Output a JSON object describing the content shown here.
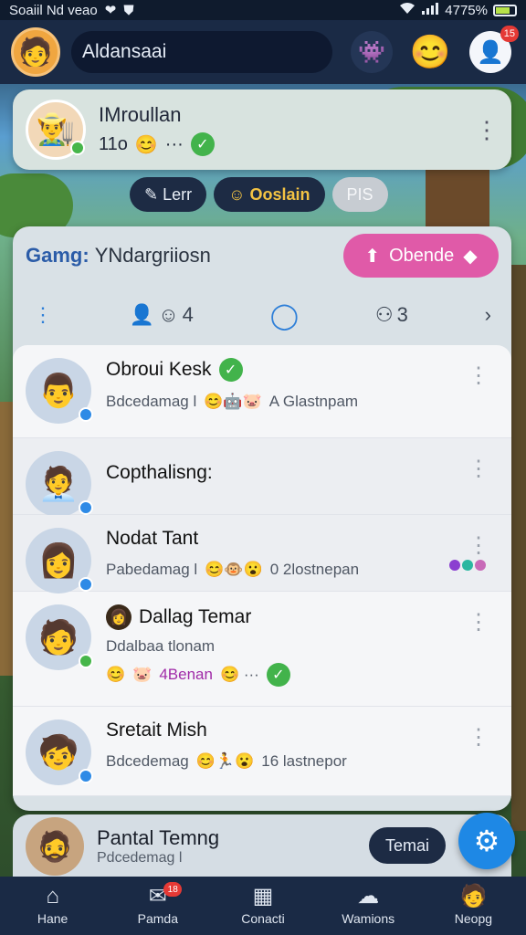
{
  "status_bar": {
    "carrier": "Soaiil Nd veao",
    "battery": "4775%"
  },
  "top_bar": {
    "search_value": "Aldansaai",
    "profile_badge": "15"
  },
  "featured": {
    "name": "IMroullan",
    "meta": "11o"
  },
  "pills": {
    "first": "Lerr",
    "second": "Ooslain",
    "third": "PIS"
  },
  "panel": {
    "title_prefix": "Gamg:",
    "title_rest": "YNdargriiosn",
    "open_button": "Obende",
    "filters": {
      "second_count": "4",
      "fourth_count": "3"
    }
  },
  "contacts": [
    {
      "name": "Obroui Kesk",
      "sub_text": "Bdcedamag l",
      "sub_tail": "A Glastnpam"
    },
    {
      "name": "Copthalisng:"
    },
    {
      "name": "Nodat Tant",
      "sub_text": "Pabedamag l",
      "sub_tail": "0 2lostnepan"
    },
    {
      "name": "Dallag Temar",
      "sub_text": "Ddalbaa tlonam",
      "sub_tail": "4Benan"
    },
    {
      "name": "Sretait Mish",
      "sub_text": "Bdcedemag",
      "sub_tail": "16 lastnepor"
    }
  ],
  "peek": {
    "name": "Pantal Temng",
    "sub_text": "Pdcedemag l",
    "button": "Temai"
  },
  "bottom_nav": {
    "items": [
      {
        "label": "Hane",
        "icon": "home-icon"
      },
      {
        "label": "Pamda",
        "icon": "chat-icon",
        "badge": "18"
      },
      {
        "label": "Conacti",
        "icon": "contacts-icon"
      },
      {
        "label": "Wamions",
        "icon": "game-icon"
      },
      {
        "label": "Neopg",
        "icon": "profile-icon"
      }
    ]
  },
  "colors": {
    "accent_blue": "#1e88e5",
    "pink_button": "#e05aa8",
    "dark_nav": "#1a2a45",
    "badge_red": "#e53935",
    "verified_green": "#46b64a"
  }
}
